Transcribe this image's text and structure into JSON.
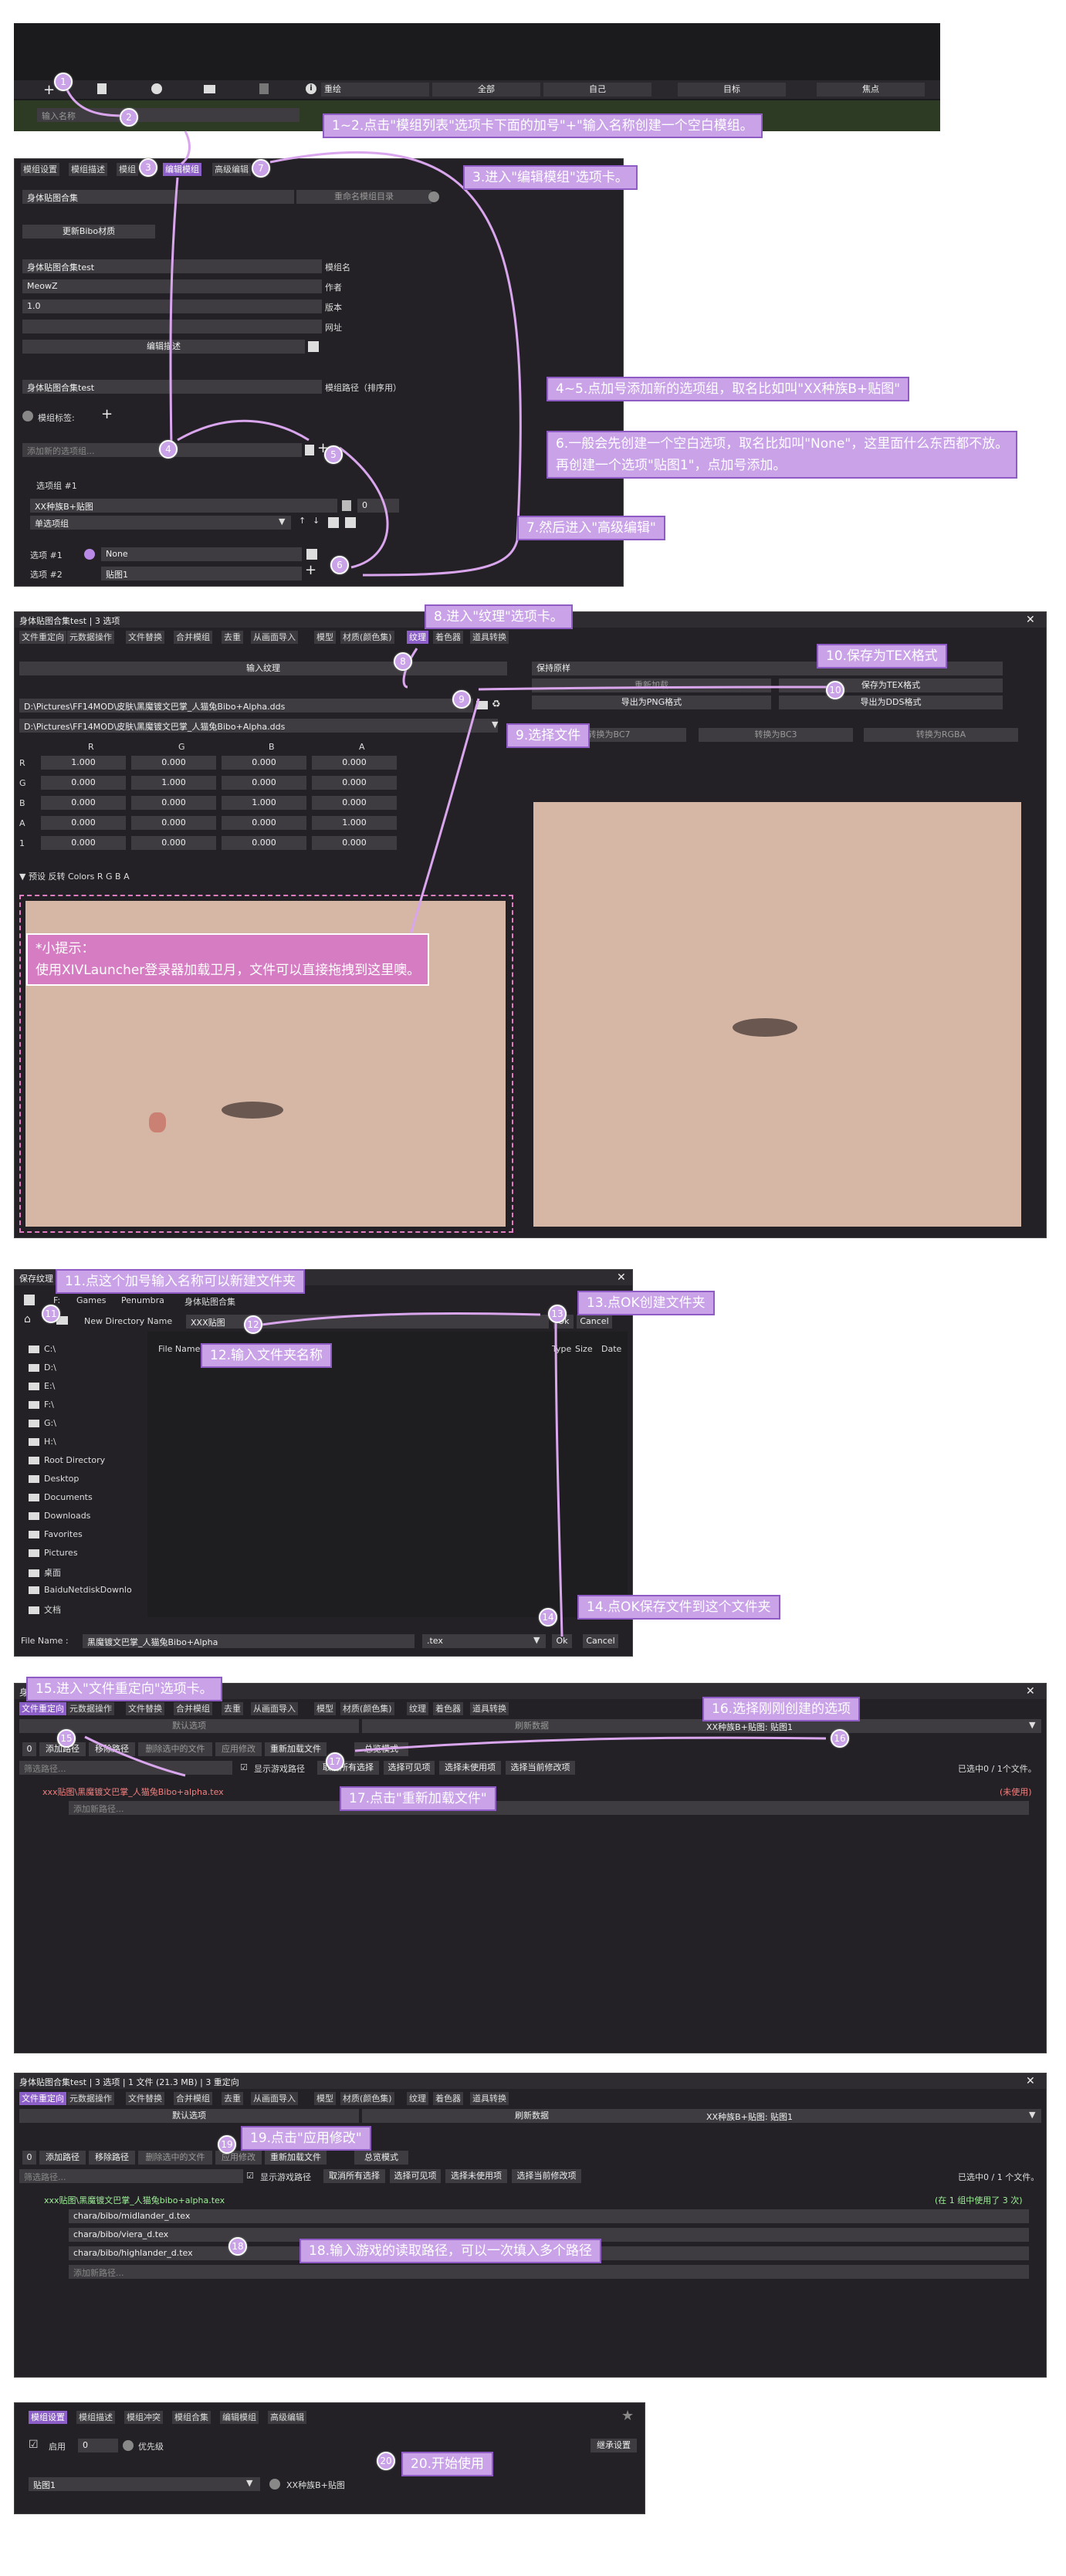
{
  "top": {
    "i_icon": "i",
    "toggle_labels": [
      "重绘",
      "全部",
      "自己",
      "目标",
      "焦点"
    ],
    "search_placeholder": "输入名称"
  },
  "callouts": {
    "c1": "1~2.点击\"模组列表\"选项卡下面的加号\"+\"输入名称创建一个空白模组。",
    "c3": "3.进入\"编辑模组\"选项卡。",
    "c45": "4~5.点加号添加新的选项组，取名比如叫\"XX种族B+贴图\"",
    "c6a": "6.一般会先创建一个空白选项，取名比如叫\"None\"，这里面什么东西都不放。",
    "c6b": "再创建一个选项\"贴图1\"，点加号添加。",
    "c7": "7.然后进入\"高级编辑\"",
    "c8": "8.进入\"纹理\"选项卡。",
    "c9": "9.选择文件",
    "c10": "10.保存为TEX格式",
    "tip1": "*小提示：",
    "tip2": "使用XIVLauncher登录器加载卫月，文件可以直接拖拽到这里噢。",
    "c11": "11.点这个加号输入名称可以新建文件夹",
    "c12": "12.输入文件夹名称",
    "c13": "13.点OK创建文件夹",
    "c14": "14.点OK保存文件到这个文件夹",
    "c15": "15.进入\"文件重定向\"选项卡。",
    "c16": "16.选择刚刚创建的选项",
    "c17": "17.点击\"重新加载文件\"",
    "c18": "18.输入游戏的读取路径，可以一次填入多个路径",
    "c19": "19.点击\"应用修改\"",
    "c20": "20.开始使用"
  },
  "nums": [
    "1",
    "2",
    "3",
    "4",
    "5",
    "6",
    "7",
    "8",
    "9",
    "10",
    "11",
    "12",
    "13",
    "14",
    "15",
    "16",
    "17",
    "18",
    "19",
    "20"
  ],
  "edit": {
    "tabs": [
      "模组设置",
      "模组描述",
      "模组",
      "编辑模组",
      "高级编辑"
    ],
    "name_value": "身体贴图合集",
    "rename_btn": "重命名模组目录",
    "update_btn": "更新Bibo材质",
    "mod_name": "身体贴图合集test",
    "mod_name_lbl": "模组名",
    "author": "MeowZ",
    "author_lbl": "作者",
    "version": "1.0",
    "version_lbl": "版本",
    "website_lbl": "网址",
    "edit_desc_btn": "编辑描述",
    "path_value": "身体贴图合集test",
    "path_lbl": "模组路径（排序用）",
    "tags_lbl": "模组标签:",
    "new_option_placeholder": "添加新的选项组...",
    "group_label": "选项组 #1",
    "group_name": "XX种族B+贴图",
    "priority": "0",
    "single": "单选项组",
    "opt1_lbl": "选项 #1",
    "opt1_val": "None",
    "opt2_lbl": "选项 #2",
    "opt2_val": "贴图1"
  },
  "tex": {
    "title": "身体贴图合集test  |  3 选项",
    "tabs": [
      "文件重定向",
      "元数据操作",
      "文件替换",
      "合并模组",
      "去重",
      "从画面导入",
      "模型",
      "材质(颜色集)",
      "纹理",
      "着色器",
      "道具转换"
    ],
    "import_btn": "输入纹理",
    "keep_btn": "保持原样",
    "path1": "D:\\Pictures\\FF14MOD\\皮肤\\黑魔镀文巴掌_人猫兔Bibo+Alpha.dds",
    "path2": "D:\\Pictures\\FF14MOD\\皮肤\\黑魔镀文巴掌_人猫兔Bibo+Alpha.dds",
    "headers": [
      "R",
      "G",
      "B",
      "A"
    ],
    "rows": [
      {
        "l": "R",
        "v": [
          "1.000",
          "0.000",
          "0.000",
          "0.000"
        ]
      },
      {
        "l": "G",
        "v": [
          "0.000",
          "1.000",
          "0.000",
          "0.000"
        ]
      },
      {
        "l": "B",
        "v": [
          "0.000",
          "0.000",
          "1.000",
          "0.000"
        ]
      },
      {
        "l": "A",
        "v": [
          "0.000",
          "0.000",
          "0.000",
          "1.000"
        ]
      },
      {
        "l": "1",
        "v": [
          "0.000",
          "0.000",
          "0.000",
          "0.000"
        ]
      }
    ],
    "preset_row": "▼ 预设    反转   Colors   R   G   B   A",
    "reload_btn": "重新加载",
    "save_tex": "保存为TEX格式",
    "export_png": "导出为PNG格式",
    "export_dds": "导出为DDS格式",
    "bc7": "转换为BC7",
    "bc3": "转换为BC3",
    "rgba": "转换为RGBA"
  },
  "save": {
    "title": "保存纹理",
    "crumb": [
      "F:",
      "Games",
      "Penumbra",
      "身体贴图合集"
    ],
    "new_dir_lbl": "New Directory Name",
    "new_dir_val": "XXX贴图",
    "ok": "Ok",
    "cancel": "Cancel",
    "cols": [
      "File Name",
      "Type",
      "Size",
      "Date"
    ],
    "tree": [
      "C:\\",
      "D:\\",
      "E:\\",
      "F:\\",
      "G:\\",
      "H:\\",
      "Root Directory",
      "Desktop",
      "Documents",
      "Downloads",
      "Favorites",
      "Pictures",
      "桌面",
      "BaiduNetdiskDownlo",
      "文档"
    ],
    "file_name_lbl": "File Name :",
    "file_name": "黑魔镀文巴掌_人猫兔Bibo+Alpha",
    "ext": ".tex"
  },
  "redir": {
    "tabs": [
      "文件重定向",
      "元数据操作",
      "文件替换",
      "合并模组",
      "去重",
      "从画面导入",
      "模型",
      "材质(颜色集)",
      "纹理",
      "着色器",
      "道具转换"
    ],
    "default_opt": "默认选项",
    "refresh": "刷新数据",
    "select_val": "XX种族B+贴图: 贴图1",
    "zero": "0",
    "add_path": "添加路径",
    "remove_path": "移除路径",
    "delete_sel": "删除选中的文件",
    "apply": "应用修改",
    "reload": "重新加载文件",
    "overview": "总览模式",
    "filter": "筛选路径...",
    "show_game": "显示游戏路径",
    "cancel_all": "取消所有选择",
    "select_visible": "选择可见项",
    "select_unused": "选择未使用项",
    "select_current": "选择当前修改项",
    "count": "已选中0 / 1个文件。",
    "file": "xxx贴图\\黑魔镀文巴掌_人猫兔Bibo+alpha.tex",
    "unused": "(未使用)",
    "add_new": "添加新路径..."
  },
  "redir2": {
    "title": "身体贴图合集test  |  3 选项  |  1 文件 (21.3 MB)  |  3 重定向",
    "count": "已选中0 / 1 个文件。",
    "file": "xxx贴图\\黑魔镀文巴掌_人猫兔bibo+alpha.tex",
    "used": "(在 1 组中使用了 3 次)",
    "paths": [
      "chara/bibo/midlander_d.tex",
      "chara/bibo/viera_d.tex",
      "chara/bibo/highlander_d.tex"
    ]
  },
  "final": {
    "tabs": [
      "模组设置",
      "模组描述",
      "模组冲突",
      "模组合集",
      "编辑模组",
      "高级编辑"
    ],
    "enabled": "启用",
    "priority": "0",
    "priority_lbl": "优先级",
    "inherit": "继承设置",
    "select_val": "贴图1",
    "group_name": "XX种族B+贴图"
  }
}
